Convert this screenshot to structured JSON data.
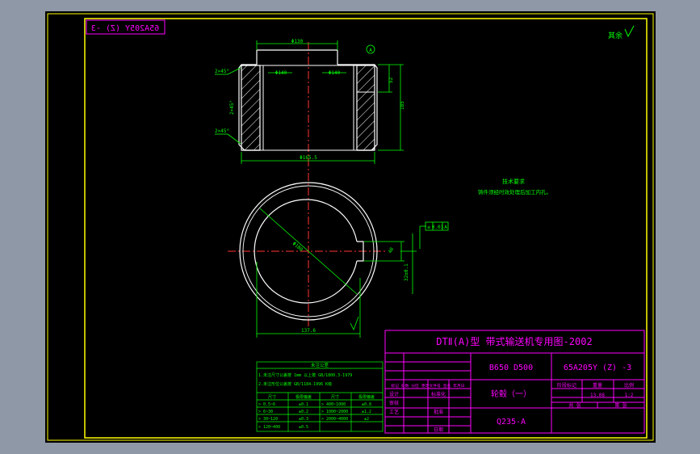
{
  "drawing": {
    "stamp_mirrored": "65A205Y (Z) -3",
    "roughness_note": "其余",
    "tech_req_title": "技术要求",
    "tech_req_text": "铸件须经时效处理后加工内孔。",
    "dimensions": {
      "top_width": "Φ130",
      "inner_left": "Φ140",
      "inner_right": "Φ140",
      "chamfer_tl": "2×45°",
      "chamfer_ml": "2×45°",
      "chamfer_bl": "2×45°",
      "outer_bottom": "Φ165.5",
      "height_1": "52",
      "height_2": "185",
      "datum_a": "A",
      "circle_dia": "Φ180",
      "bottom_dim": "137.6",
      "keyway_width": "40",
      "keyway_offset": "32±0.1",
      "tol_sym": "≡",
      "tol_val": "0.03",
      "tol_datum": "A"
    },
    "tolerance_table": {
      "title": "未注公差",
      "notes": [
        "1.未注尺寸公差按 1mm 以上按 GB/1800.3-1979",
        "2.未注形位公差按 GB/1184-1996 K级"
      ],
      "headers": [
        "尺寸",
        "极限偏差",
        "尺寸",
        "极限偏差"
      ],
      "rows": [
        [
          "> 0.5~6",
          "±0.1",
          "> 400~1000",
          "±0.8"
        ],
        [
          "> 6~30",
          "±0.2",
          "> 1000~2000",
          "±1.2"
        ],
        [
          "> 30~120",
          "±0.3",
          "> 2000~4000",
          "±2"
        ],
        [
          "> 120~400",
          "±0.5",
          "",
          ""
        ]
      ]
    },
    "title_block": {
      "header": "DTⅡ(A)型  带式输送机专用图-2002",
      "spec": "B650 D500",
      "drawing_no": "65A205Y (Z) -3",
      "part_name": "轮毂（一）",
      "material": "Q235-A",
      "rev_header": "标记 处数 分区 更改文件号 签名 年月日",
      "roles": [
        "设计",
        "审核",
        "工艺"
      ],
      "roles2": [
        "标准化",
        "批准",
        "日期"
      ],
      "stage_label": "阶段标记",
      "weight_label": "重量",
      "scale_label": "比例",
      "weight": "13.08",
      "scale": "1:2",
      "sheet_total": "共   张",
      "sheet_no": "第   张"
    }
  }
}
